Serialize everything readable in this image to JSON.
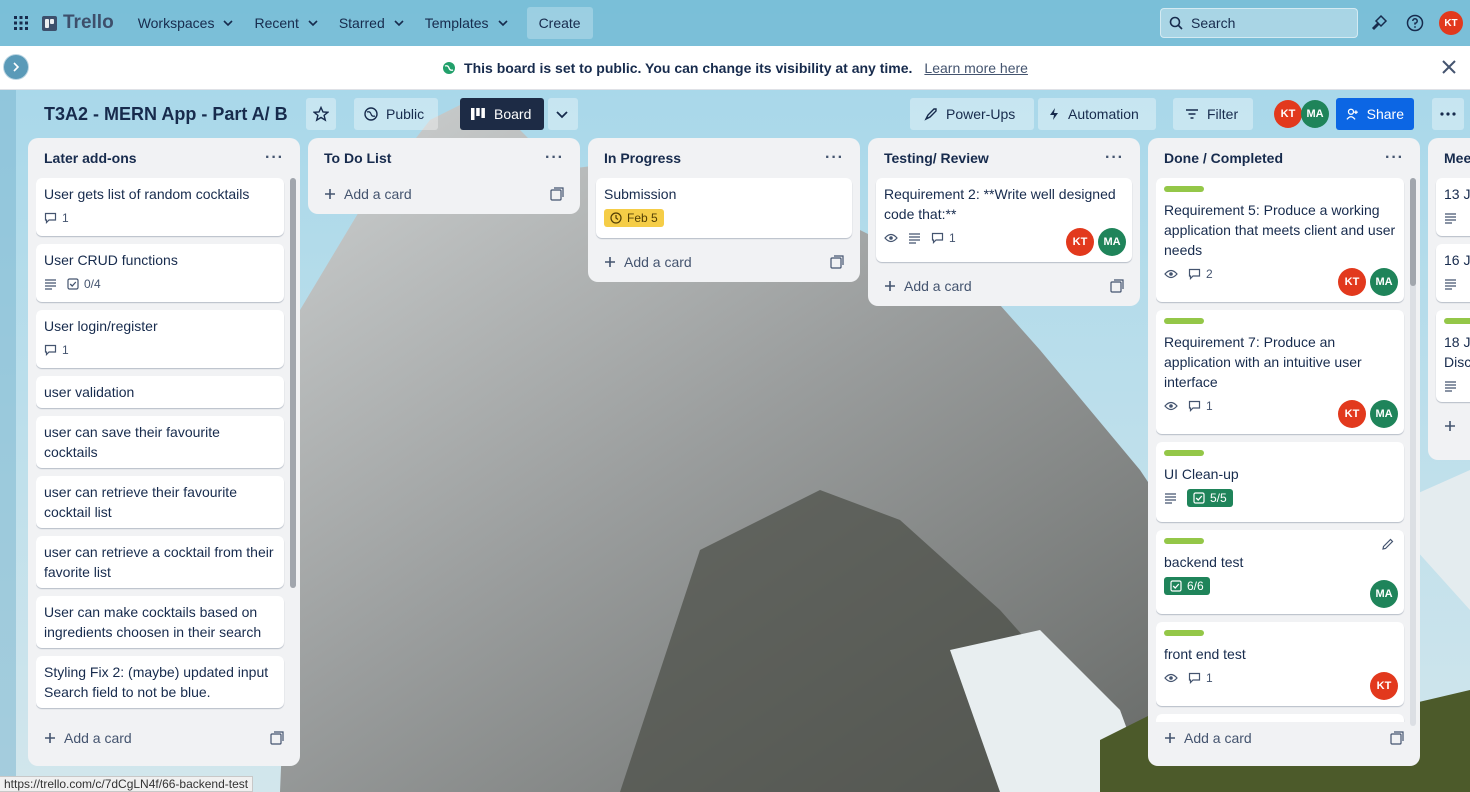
{
  "topnav": {
    "logo": "Trello",
    "menus": [
      "Workspaces",
      "Recent",
      "Starred",
      "Templates"
    ],
    "create_label": "Create",
    "search_placeholder": "Search",
    "user_initials": "KT"
  },
  "banner": {
    "message": "This board is set to public. You can change its visibility at any time.",
    "link": "Learn more here"
  },
  "board": {
    "title": "T3A2 - MERN App - Part A/ B",
    "visibility": "Public",
    "view": "Board",
    "power_ups": "Power-Ups",
    "automation": "Automation",
    "filter": "Filter",
    "share": "Share",
    "members": [
      "KT",
      "MA"
    ]
  },
  "lists": [
    {
      "title": "Later add-ons",
      "add_label": "Add a card",
      "cards": [
        {
          "title": "User gets list of random cocktails",
          "comments": "1"
        },
        {
          "title": "User CRUD functions",
          "checklist": "0/4"
        },
        {
          "title": "User login/register",
          "comments": "1"
        },
        {
          "title": "user validation"
        },
        {
          "title": "user can save their favourite cocktails"
        },
        {
          "title": "user can retrieve their favourite cocktail list"
        },
        {
          "title": "user can retrieve a cocktail from their favorite list"
        },
        {
          "title": "User can make cocktails based on ingredients choosen in their search"
        },
        {
          "title": "Styling Fix 2: (maybe) updated input Search field to not be blue."
        }
      ]
    },
    {
      "title": "To Do List",
      "add_label": "Add a card",
      "cards": []
    },
    {
      "title": "In Progress",
      "add_label": "Add a card",
      "cards": [
        {
          "title": "Submission",
          "due": "Feb 5"
        }
      ]
    },
    {
      "title": "Testing/ Review",
      "add_label": "Add a card",
      "cards": [
        {
          "title": "Requirement 2: **Write well designed code that:**",
          "comments": "1",
          "members": [
            "KT",
            "MA"
          ]
        }
      ]
    },
    {
      "title": "Done / Completed",
      "add_label": "Add a card",
      "cards": [
        {
          "title": "Requirement 5: Produce a working application that meets client and user needs",
          "comments": "2",
          "members": [
            "KT",
            "MA"
          ]
        },
        {
          "title": "Requirement 7: Produce an application with an intuitive user interface",
          "comments": "1",
          "members": [
            "KT",
            "MA"
          ]
        },
        {
          "title": "UI Clean-up",
          "checklist": "5/5"
        },
        {
          "title": "backend test",
          "checklist": "6/6",
          "members": [
            "MA"
          ]
        },
        {
          "title": "front end test",
          "comments": "1",
          "members": [
            "KT"
          ]
        }
      ]
    },
    {
      "title": "Mee",
      "cards": [
        {
          "title": "13 J"
        },
        {
          "title": "16 J"
        },
        {
          "title": "18 J Disc"
        }
      ]
    }
  ],
  "status_url": "https://trello.com/c/7dCgLN4f/66-backend-test",
  "colors": {
    "accent": "#0c66e4",
    "label_green": "#94c748",
    "kt": "#e2391d",
    "ma": "#1f845a"
  }
}
